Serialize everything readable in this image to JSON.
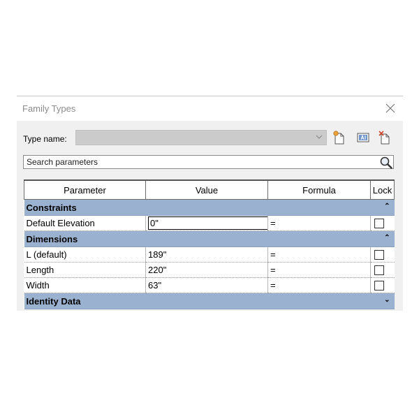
{
  "window": {
    "title": "Family Types"
  },
  "toolbar": {
    "type_name_label": "Type name:",
    "type_name_value": "",
    "icons": [
      "new-type-icon",
      "rename-type-icon",
      "delete-type-icon"
    ]
  },
  "search": {
    "placeholder": "Search parameters",
    "value": ""
  },
  "table": {
    "headers": {
      "parameter": "Parameter",
      "value": "Value",
      "formula": "Formula",
      "lock": "Lock"
    },
    "groups": [
      {
        "name": "Constraints",
        "expanded": true,
        "rows": [
          {
            "parameter": "Default Elevation",
            "value": "0\"",
            "formula": "=",
            "locked": false
          }
        ]
      },
      {
        "name": "Dimensions",
        "expanded": true,
        "rows": [
          {
            "parameter": "L (default)",
            "value": "189\"",
            "formula": "=",
            "locked": false
          },
          {
            "parameter": "Length",
            "value": "220\"",
            "formula": "=",
            "locked": false
          },
          {
            "parameter": "Width",
            "value": "63\"",
            "formula": "=",
            "locked": false
          }
        ]
      },
      {
        "name": "Identity Data",
        "expanded": false,
        "rows": []
      }
    ]
  },
  "colors": {
    "group_header": "#9ab1cf",
    "dialog_bg": "#f0f0f0",
    "combo_bg": "#cbcbcb"
  }
}
